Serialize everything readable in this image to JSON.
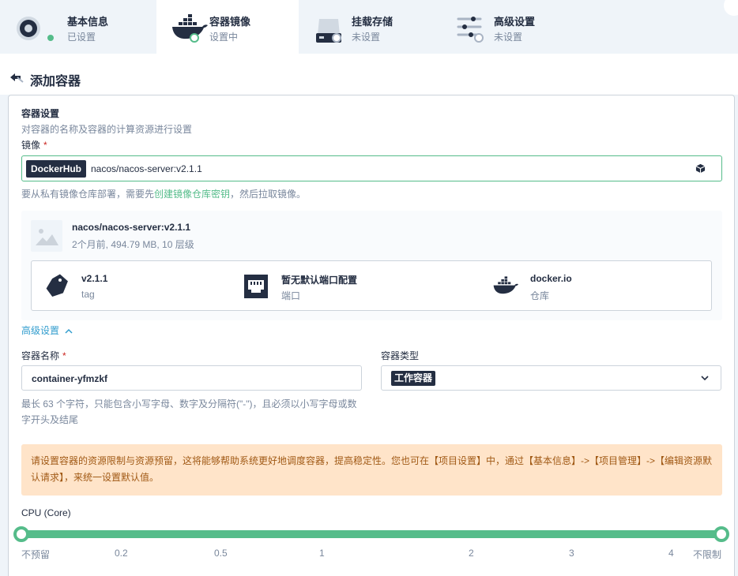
{
  "steps": [
    {
      "title": "基本信息",
      "status": "已设置",
      "icon": "settings-disc-icon",
      "state": "done"
    },
    {
      "title": "容器镜像",
      "status": "设置中",
      "icon": "docker-icon",
      "state": "current"
    },
    {
      "title": "挂载存储",
      "status": "未设置",
      "icon": "storage-disk-icon",
      "state": "todo"
    },
    {
      "title": "高级设置",
      "status": "未设置",
      "icon": "sliders-icon",
      "state": "todo"
    }
  ],
  "page": {
    "title": "添加容器"
  },
  "container_settings": {
    "title": "容器设置",
    "description": "对容器的名称及容器的计算资源进行设置",
    "image_label": "镜像",
    "required_mark": "*",
    "registry_tag": "DockerHub",
    "image_value": "nacos/nacos-server:v2.1.1",
    "hint_prefix": "要从私有镜像仓库部署，需要先",
    "hint_link": "创建镜像仓库密钥",
    "hint_suffix": "，然后拉取镜像。"
  },
  "image_info": {
    "name": "nacos/nacos-server:v2.1.1",
    "meta": "2个月前, 494.79 MB, 10 层级",
    "items": [
      {
        "value": "v2.1.1",
        "label": "tag",
        "icon": "tag-icon"
      },
      {
        "value": "暂无默认端口配置",
        "label": "端口",
        "icon": "port-icon"
      },
      {
        "value": "docker.io",
        "label": "仓库",
        "icon": "docker-icon"
      }
    ]
  },
  "advanced_toggle": "高级设置",
  "container_name": {
    "label": "容器名称",
    "value": "container-yfmzkf",
    "hint_line1": "最长 63 个字符，只能包含小写字母、数字及分隔符(\"-\")，且必须以小写字母或数",
    "hint_line2": "字开头及结尾"
  },
  "container_type": {
    "label": "容器类型",
    "value": "工作容器"
  },
  "warning": {
    "line1": "请设置容器的资源限制与资源预留，这将能够帮助系统更好地调度容器，提高稳定性。您也可在【项目设置】中，通过【基本信息】->【项目管理】->【编辑资源默",
    "line2": "认请求】，来统一设置默认值。"
  },
  "cpu": {
    "label": "CPU (Core)",
    "ticks": [
      "不预留",
      "0.2",
      "0.5",
      "1",
      "2",
      "3",
      "4",
      "不限制"
    ],
    "min_value": "不预留",
    "max_value": "不限制"
  },
  "colors": {
    "accent": "#55bc8a",
    "dark": "#242e42",
    "muted": "#79879c",
    "link": "#329dce",
    "warning_bg": "#ffe4c9"
  }
}
